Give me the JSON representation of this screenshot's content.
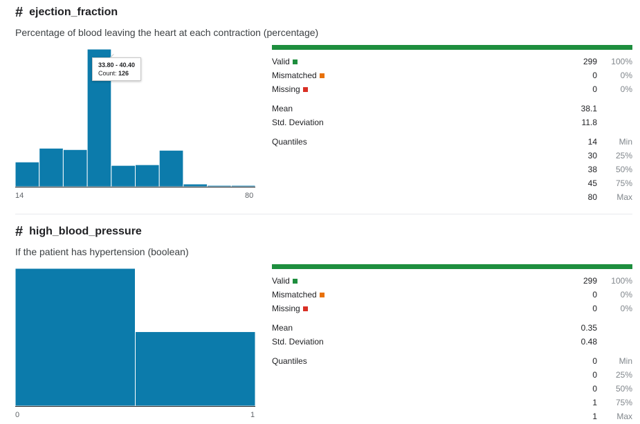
{
  "columns": [
    {
      "name": "ejection_fraction",
      "icon": "hash-icon",
      "description": "Percentage of blood leaving the heart at each contraction (percentage)",
      "histogram": {
        "x_min_label": "14",
        "x_max_label": "80",
        "bin_heights": [
          0.18,
          0.28,
          0.27,
          1.0,
          0.155,
          0.16,
          0.265,
          0.02,
          0.01,
          0.01
        ],
        "bar_color": "#0c7bab",
        "tooltip": {
          "range": "33.80 - 40.40",
          "count_label": "Count:",
          "count": "126",
          "bin_index": 3
        }
      },
      "stats": {
        "valid": {
          "label": "Valid",
          "value": "299",
          "pct": "100%",
          "color": "#1e8e3e"
        },
        "mismatched": {
          "label": "Mismatched",
          "value": "0",
          "pct": "0%",
          "color": "#e8710a"
        },
        "missing": {
          "label": "Missing",
          "value": "0",
          "pct": "0%",
          "color": "#d93025"
        },
        "mean": {
          "label": "Mean",
          "value": "38.1"
        },
        "std": {
          "label": "Std. Deviation",
          "value": "11.8"
        },
        "quantiles_label": "Quantiles",
        "quantiles": [
          {
            "value": "14",
            "label": "Min"
          },
          {
            "value": "30",
            "label": "25%"
          },
          {
            "value": "38",
            "label": "50%"
          },
          {
            "value": "45",
            "label": "75%"
          },
          {
            "value": "80",
            "label": "Max"
          }
        ]
      }
    },
    {
      "name": "high_blood_pressure",
      "icon": "hash-icon",
      "description": "If the patient has hypertension (boolean)",
      "histogram": {
        "x_min_label": "0",
        "x_max_label": "1",
        "bin_heights": [
          1.0,
          0.54
        ],
        "bar_color": "#0c7bab"
      },
      "stats": {
        "valid": {
          "label": "Valid",
          "value": "299",
          "pct": "100%",
          "color": "#1e8e3e"
        },
        "mismatched": {
          "label": "Mismatched",
          "value": "0",
          "pct": "0%",
          "color": "#e8710a"
        },
        "missing": {
          "label": "Missing",
          "value": "0",
          "pct": "0%",
          "color": "#d93025"
        },
        "mean": {
          "label": "Mean",
          "value": "0.35"
        },
        "std": {
          "label": "Std. Deviation",
          "value": "0.48"
        },
        "quantiles_label": "Quantiles",
        "quantiles": [
          {
            "value": "0",
            "label": "Min"
          },
          {
            "value": "0",
            "label": "25%"
          },
          {
            "value": "0",
            "label": "50%"
          },
          {
            "value": "1",
            "label": "75%"
          },
          {
            "value": "1",
            "label": "Max"
          }
        ]
      }
    }
  ]
}
